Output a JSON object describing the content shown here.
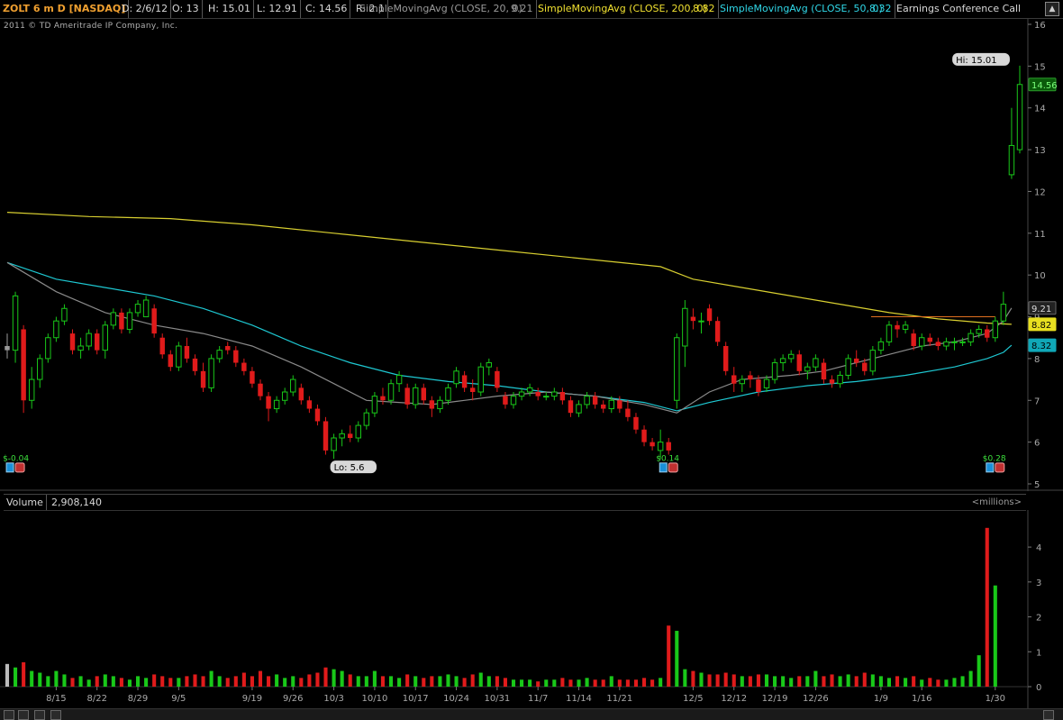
{
  "header": {
    "symbol": "ZOLT 6 m D [NASDAQ]",
    "date": "D: 2/6/12",
    "open": "O: 13",
    "high": "H: 15.01",
    "low": "L: 12.91",
    "close": "C: 14.56",
    "range": "R: 2.1",
    "sma20_label": "SimpleMovingAvg (CLOSE, 20, 0)",
    "sma20_value": "9.21",
    "sma200_label": "SimpleMovingAvg (CLOSE, 200, 0)",
    "sma200_value": "8.82",
    "sma50_label": "SimpleMovingAvg (CLOSE, 50, 0)",
    "sma50_value": "8.32",
    "earnings_label": "Earnings Conference Call"
  },
  "copyright": "2011 © TD Ameritrade IP Company, Inc.",
  "volume_header": {
    "label": "Volume",
    "value": "2,908,140",
    "units": "<millions>"
  },
  "colors": {
    "up": "#19c819",
    "down": "#e01b1b",
    "sma200": "#d8cf30",
    "sma50": "#1ec8d2",
    "sma20": "#8a8a8a",
    "background": "#000000"
  },
  "icons": [
    "earnings-call-icon",
    "dividend-icon",
    "chart-settings-icon"
  ],
  "chart_data": [
    {
      "type": "candlestick",
      "title": "ZOLT 6 m D [NASDAQ]",
      "ylim": [
        5,
        16
      ],
      "y_ticks": [
        5,
        6,
        7,
        8,
        9,
        10,
        11,
        12,
        13,
        14,
        15,
        16
      ],
      "x_tick_labels": [
        {
          "label": "8/15",
          "index": 6
        },
        {
          "label": "8/22",
          "index": 11
        },
        {
          "label": "8/29",
          "index": 16
        },
        {
          "label": "9/5",
          "index": 21
        },
        {
          "label": "9/19",
          "index": 30
        },
        {
          "label": "9/26",
          "index": 35
        },
        {
          "label": "10/3",
          "index": 40
        },
        {
          "label": "10/10",
          "index": 45
        },
        {
          "label": "10/17",
          "index": 50
        },
        {
          "label": "10/24",
          "index": 55
        },
        {
          "label": "10/31",
          "index": 60
        },
        {
          "label": "11/7",
          "index": 65
        },
        {
          "label": "11/14",
          "index": 70
        },
        {
          "label": "11/21",
          "index": 75
        },
        {
          "label": "12/5",
          "index": 84
        },
        {
          "label": "12/12",
          "index": 89
        },
        {
          "label": "12/19",
          "index": 94
        },
        {
          "label": "12/26",
          "index": 99
        },
        {
          "label": "1/9",
          "index": 107
        },
        {
          "label": "1/16",
          "index": 112
        },
        {
          "label": "1/30",
          "index": 121
        }
      ],
      "candles": [
        [
          8.3,
          8.6,
          8.0,
          8.2
        ],
        [
          8.2,
          9.6,
          7.9,
          9.5
        ],
        [
          8.7,
          8.8,
          6.7,
          7.0
        ],
        [
          7.0,
          7.8,
          6.8,
          7.5
        ],
        [
          7.5,
          8.1,
          7.3,
          8.0
        ],
        [
          8.0,
          8.6,
          7.9,
          8.5
        ],
        [
          8.5,
          9.0,
          8.4,
          8.9
        ],
        [
          8.9,
          9.3,
          8.8,
          9.2
        ],
        [
          8.6,
          8.7,
          8.1,
          8.2
        ],
        [
          8.2,
          8.5,
          8.0,
          8.3
        ],
        [
          8.3,
          8.7,
          8.2,
          8.6
        ],
        [
          8.6,
          8.7,
          8.1,
          8.2
        ],
        [
          8.2,
          8.9,
          8.0,
          8.8
        ],
        [
          8.8,
          9.2,
          8.7,
          9.1
        ],
        [
          9.1,
          9.2,
          8.6,
          8.7
        ],
        [
          8.7,
          9.2,
          8.6,
          9.1
        ],
        [
          9.1,
          9.4,
          9.0,
          9.3
        ],
        [
          9.0,
          9.5,
          9.0,
          9.4
        ],
        [
          9.2,
          9.3,
          8.5,
          8.6
        ],
        [
          8.5,
          8.6,
          8.0,
          8.1
        ],
        [
          8.1,
          8.2,
          7.7,
          7.8
        ],
        [
          7.8,
          8.4,
          7.7,
          8.3
        ],
        [
          8.3,
          8.5,
          7.9,
          8.0
        ],
        [
          8.0,
          8.1,
          7.6,
          7.7
        ],
        [
          7.7,
          7.9,
          7.2,
          7.3
        ],
        [
          7.3,
          8.1,
          7.2,
          8.0
        ],
        [
          8.0,
          8.3,
          7.9,
          8.2
        ],
        [
          8.3,
          8.4,
          8.1,
          8.2
        ],
        [
          8.2,
          8.3,
          7.8,
          7.9
        ],
        [
          7.9,
          8.0,
          7.6,
          7.7
        ],
        [
          7.7,
          7.8,
          7.3,
          7.4
        ],
        [
          7.4,
          7.5,
          7.0,
          7.1
        ],
        [
          7.1,
          7.2,
          6.5,
          6.8
        ],
        [
          6.8,
          7.1,
          6.7,
          7.0
        ],
        [
          7.0,
          7.3,
          6.9,
          7.2
        ],
        [
          7.2,
          7.6,
          7.1,
          7.5
        ],
        [
          7.3,
          7.4,
          6.9,
          7.0
        ],
        [
          7.0,
          7.1,
          6.7,
          6.8
        ],
        [
          6.8,
          6.9,
          6.4,
          6.5
        ],
        [
          6.5,
          6.6,
          5.7,
          5.8
        ],
        [
          5.8,
          6.2,
          5.6,
          6.1
        ],
        [
          6.1,
          6.3,
          5.9,
          6.2
        ],
        [
          6.2,
          6.4,
          6.0,
          6.1
        ],
        [
          6.1,
          6.5,
          6.0,
          6.4
        ],
        [
          6.4,
          6.8,
          6.3,
          6.7
        ],
        [
          6.7,
          7.2,
          6.6,
          7.1
        ],
        [
          7.1,
          7.3,
          6.9,
          7.0
        ],
        [
          7.0,
          7.5,
          6.9,
          7.4
        ],
        [
          7.4,
          7.7,
          7.2,
          7.6
        ],
        [
          7.3,
          7.4,
          6.8,
          6.9
        ],
        [
          6.9,
          7.4,
          6.8,
          7.3
        ],
        [
          7.3,
          7.4,
          6.9,
          7.0
        ],
        [
          7.0,
          7.1,
          6.6,
          6.8
        ],
        [
          6.8,
          7.1,
          6.7,
          7.0
        ],
        [
          7.0,
          7.4,
          6.9,
          7.3
        ],
        [
          7.4,
          7.8,
          7.3,
          7.7
        ],
        [
          7.6,
          7.7,
          7.2,
          7.3
        ],
        [
          7.3,
          7.5,
          7.0,
          7.2
        ],
        [
          7.2,
          7.9,
          7.1,
          7.8
        ],
        [
          7.8,
          8.0,
          7.6,
          7.9
        ],
        [
          7.7,
          7.8,
          7.2,
          7.3
        ],
        [
          7.1,
          7.2,
          6.8,
          6.9
        ],
        [
          6.9,
          7.2,
          6.8,
          7.1
        ],
        [
          7.1,
          7.3,
          7.0,
          7.2
        ],
        [
          7.2,
          7.4,
          7.1,
          7.3
        ],
        [
          7.2,
          7.3,
          7.0,
          7.1
        ],
        [
          7.1,
          7.2,
          7.0,
          7.1
        ],
        [
          7.1,
          7.3,
          7.0,
          7.2
        ],
        [
          7.2,
          7.3,
          6.9,
          7.0
        ],
        [
          7.0,
          7.1,
          6.6,
          6.7
        ],
        [
          6.7,
          7.0,
          6.6,
          6.9
        ],
        [
          6.9,
          7.2,
          6.8,
          7.1
        ],
        [
          7.1,
          7.2,
          6.8,
          6.9
        ],
        [
          6.9,
          7.0,
          6.7,
          6.8
        ],
        [
          6.8,
          7.1,
          6.7,
          7.0
        ],
        [
          7.0,
          7.1,
          6.7,
          6.8
        ],
        [
          6.8,
          7.0,
          6.5,
          6.6
        ],
        [
          6.6,
          6.7,
          6.2,
          6.3
        ],
        [
          6.3,
          6.4,
          5.9,
          6.0
        ],
        [
          6.0,
          6.1,
          5.8,
          5.9
        ],
        [
          5.8,
          6.3,
          5.6,
          6.0
        ],
        [
          6.0,
          6.1,
          5.7,
          5.8
        ],
        [
          7.0,
          8.6,
          6.8,
          8.5
        ],
        [
          8.3,
          9.4,
          7.8,
          9.2
        ],
        [
          9.0,
          9.2,
          8.7,
          8.9
        ],
        [
          8.9,
          9.1,
          8.6,
          8.9
        ],
        [
          9.2,
          9.3,
          8.8,
          8.9
        ],
        [
          8.9,
          9.0,
          8.3,
          8.4
        ],
        [
          8.3,
          8.4,
          7.6,
          7.7
        ],
        [
          7.6,
          7.8,
          7.2,
          7.4
        ],
        [
          7.4,
          7.6,
          7.2,
          7.5
        ],
        [
          7.6,
          7.7,
          7.3,
          7.5
        ],
        [
          7.5,
          7.6,
          7.1,
          7.2
        ],
        [
          7.3,
          7.6,
          7.2,
          7.5
        ],
        [
          7.5,
          8.0,
          7.4,
          7.9
        ],
        [
          7.9,
          8.1,
          7.7,
          8.0
        ],
        [
          8.0,
          8.2,
          7.9,
          8.1
        ],
        [
          8.1,
          8.2,
          7.6,
          7.7
        ],
        [
          7.7,
          7.9,
          7.5,
          7.8
        ],
        [
          7.8,
          8.1,
          7.7,
          8.0
        ],
        [
          7.9,
          8.0,
          7.4,
          7.5
        ],
        [
          7.5,
          7.6,
          7.3,
          7.4
        ],
        [
          7.4,
          7.7,
          7.3,
          7.6
        ],
        [
          7.6,
          8.1,
          7.5,
          8.0
        ],
        [
          8.0,
          8.2,
          7.8,
          7.9
        ],
        [
          7.9,
          8.0,
          7.6,
          7.7
        ],
        [
          7.7,
          8.3,
          7.6,
          8.2
        ],
        [
          8.2,
          8.5,
          8.1,
          8.4
        ],
        [
          8.4,
          8.9,
          8.3,
          8.8
        ],
        [
          8.8,
          8.9,
          8.5,
          8.7
        ],
        [
          8.7,
          8.9,
          8.6,
          8.8
        ],
        [
          8.6,
          8.7,
          8.2,
          8.3
        ],
        [
          8.3,
          8.6,
          8.2,
          8.5
        ],
        [
          8.5,
          8.6,
          8.3,
          8.4
        ],
        [
          8.4,
          8.5,
          8.2,
          8.3
        ],
        [
          8.3,
          8.5,
          8.2,
          8.4
        ],
        [
          8.4,
          8.5,
          8.2,
          8.4
        ],
        [
          8.4,
          8.5,
          8.3,
          8.4
        ],
        [
          8.4,
          8.7,
          8.3,
          8.6
        ],
        [
          8.6,
          8.8,
          8.5,
          8.7
        ],
        [
          8.7,
          8.8,
          8.4,
          8.5
        ],
        [
          8.5,
          9.0,
          8.4,
          8.9
        ],
        [
          8.9,
          9.6,
          8.8,
          9.3
        ],
        [
          12.4,
          14.0,
          12.3,
          13.1
        ],
        [
          13.0,
          15.01,
          12.91,
          14.56
        ]
      ],
      "first_candle_color": "gray",
      "sma20": [
        [
          0,
          10.3
        ],
        [
          6,
          9.6
        ],
        [
          12,
          9.1
        ],
        [
          18,
          8.8
        ],
        [
          24,
          8.6
        ],
        [
          30,
          8.3
        ],
        [
          36,
          7.8
        ],
        [
          40,
          7.4
        ],
        [
          44,
          7.0
        ],
        [
          48,
          6.95
        ],
        [
          52,
          6.9
        ],
        [
          56,
          7.0
        ],
        [
          60,
          7.1
        ],
        [
          66,
          7.2
        ],
        [
          72,
          7.1
        ],
        [
          78,
          6.9
        ],
        [
          82,
          6.7
        ],
        [
          86,
          7.2
        ],
        [
          90,
          7.5
        ],
        [
          96,
          7.6
        ],
        [
          100,
          7.7
        ],
        [
          104,
          7.9
        ],
        [
          108,
          8.1
        ],
        [
          112,
          8.3
        ],
        [
          116,
          8.4
        ],
        [
          120,
          8.6
        ],
        [
          122,
          8.9
        ],
        [
          123,
          9.21
        ]
      ],
      "sma50": [
        [
          0,
          10.3
        ],
        [
          6,
          9.9
        ],
        [
          12,
          9.7
        ],
        [
          18,
          9.5
        ],
        [
          24,
          9.2
        ],
        [
          30,
          8.8
        ],
        [
          36,
          8.3
        ],
        [
          42,
          7.9
        ],
        [
          48,
          7.6
        ],
        [
          54,
          7.45
        ],
        [
          60,
          7.35
        ],
        [
          66,
          7.2
        ],
        [
          72,
          7.1
        ],
        [
          78,
          6.95
        ],
        [
          82,
          6.75
        ],
        [
          86,
          6.95
        ],
        [
          92,
          7.2
        ],
        [
          98,
          7.35
        ],
        [
          104,
          7.45
        ],
        [
          110,
          7.6
        ],
        [
          116,
          7.8
        ],
        [
          120,
          8.0
        ],
        [
          122,
          8.15
        ],
        [
          123,
          8.32
        ]
      ],
      "sma200": [
        [
          0,
          11.5
        ],
        [
          10,
          11.4
        ],
        [
          20,
          11.35
        ],
        [
          30,
          11.2
        ],
        [
          40,
          11.0
        ],
        [
          50,
          10.8
        ],
        [
          60,
          10.6
        ],
        [
          70,
          10.4
        ],
        [
          80,
          10.2
        ],
        [
          84,
          9.9
        ],
        [
          90,
          9.7
        ],
        [
          96,
          9.5
        ],
        [
          102,
          9.3
        ],
        [
          108,
          9.1
        ],
        [
          114,
          8.95
        ],
        [
          120,
          8.85
        ],
        [
          123,
          8.82
        ]
      ],
      "annotations": [
        {
          "label": "Hi: 15.01",
          "index": 123,
          "value": 15.01
        },
        {
          "label": "Lo: 5.6",
          "index": 40,
          "value": 5.6
        },
        {
          "label": "14.56",
          "type": "price-tag",
          "value": 14.56
        },
        {
          "label": "9.21",
          "type": "price-tag",
          "value": 9.21
        },
        {
          "label": "8.82",
          "type": "price-tag",
          "value": 8.82
        },
        {
          "label": "8.32",
          "type": "price-tag",
          "value": 8.32
        }
      ],
      "earnings": [
        {
          "label": "$-0.04",
          "index": 1
        },
        {
          "label": "$0.14",
          "index": 81
        },
        {
          "label": "$0.28",
          "index": 121
        }
      ],
      "resistance_line": {
        "from_index": 108,
        "to_index": 121,
        "value": 9.0
      }
    },
    {
      "type": "bar",
      "title": "Volume",
      "ylim": [
        0,
        4.7
      ],
      "y_ticks": [
        0,
        1,
        2,
        3,
        4
      ],
      "units": "millions",
      "values": [
        0.65,
        0.55,
        0.7,
        0.45,
        0.4,
        0.3,
        0.45,
        0.35,
        0.25,
        0.3,
        0.2,
        0.3,
        0.35,
        0.3,
        0.25,
        0.2,
        0.3,
        0.25,
        0.35,
        0.3,
        0.25,
        0.25,
        0.3,
        0.35,
        0.3,
        0.45,
        0.3,
        0.25,
        0.3,
        0.4,
        0.3,
        0.45,
        0.3,
        0.35,
        0.25,
        0.3,
        0.25,
        0.35,
        0.4,
        0.55,
        0.5,
        0.45,
        0.35,
        0.3,
        0.3,
        0.45,
        0.3,
        0.3,
        0.25,
        0.35,
        0.3,
        0.25,
        0.3,
        0.3,
        0.35,
        0.3,
        0.25,
        0.35,
        0.4,
        0.3,
        0.3,
        0.25,
        0.2,
        0.2,
        0.2,
        0.15,
        0.2,
        0.2,
        0.25,
        0.2,
        0.2,
        0.25,
        0.2,
        0.2,
        0.3,
        0.2,
        0.2,
        0.2,
        0.25,
        0.2,
        0.25,
        1.75,
        1.6,
        0.5,
        0.45,
        0.4,
        0.35,
        0.35,
        0.4,
        0.35,
        0.3,
        0.3,
        0.35,
        0.35,
        0.3,
        0.3,
        0.25,
        0.3,
        0.3,
        0.45,
        0.3,
        0.35,
        0.3,
        0.35,
        0.3,
        0.4,
        0.35,
        0.3,
        0.25,
        0.3,
        0.25,
        0.3,
        0.2,
        0.25,
        0.2,
        0.2,
        0.25,
        0.3,
        0.45,
        0.9,
        4.55,
        2.9
      ]
    }
  ]
}
